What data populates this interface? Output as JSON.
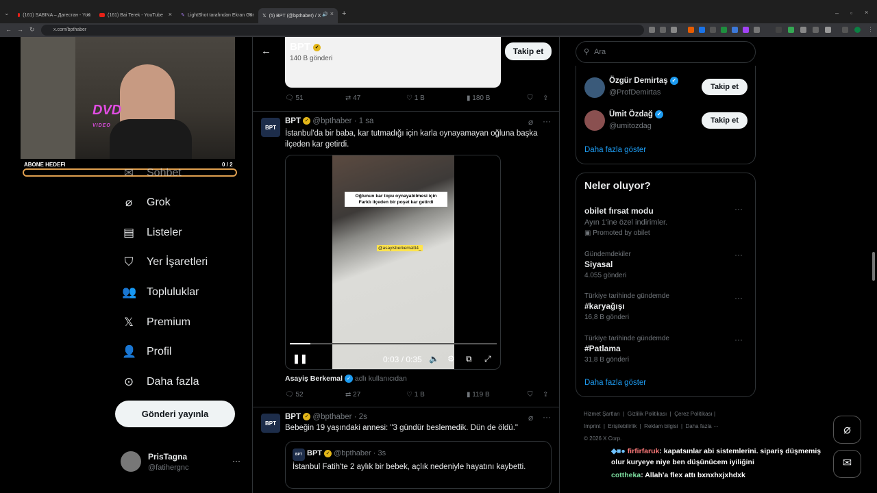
{
  "tabs": [
    {
      "label": "(161) SABINA – Дагестан - You"
    },
    {
      "label": "(161) Bai Terek - YouTube"
    },
    {
      "label": "LightShot tarafından Ekran Gör"
    },
    {
      "label": "(5) BPT (@bpthaber) / X"
    }
  ],
  "address": "x.com/bpthaber",
  "stream": {
    "goal_label": "ABONE HEDEFI",
    "goal_value": "0 / 2",
    "dvd_line1": "DVD",
    "dvd_line2": "VIDEO"
  },
  "nav": [
    {
      "label": "Sohbet",
      "icon": "mail-icon"
    },
    {
      "label": "Grok",
      "icon": "grok-icon"
    },
    {
      "label": "Listeler",
      "icon": "list-icon"
    },
    {
      "label": "Yer İşaretleri",
      "icon": "bookmark-icon"
    },
    {
      "label": "Topluluklar",
      "icon": "communities-icon"
    },
    {
      "label": "Premium",
      "icon": "x-logo-icon"
    },
    {
      "label": "Profil",
      "icon": "profile-icon"
    },
    {
      "label": "Daha fazla",
      "icon": "more-circle-icon"
    }
  ],
  "post_button": "Gönderi yayınla",
  "account": {
    "name": "PrisTagna",
    "handle": "@fatihergnc"
  },
  "header": {
    "title": "BPT",
    "subtitle": "140 B gönderi",
    "follow": "Takip et"
  },
  "prev_actions": {
    "replies": "51",
    "reposts": "47",
    "likes": "1 B",
    "views": "180 B"
  },
  "tweet1": {
    "name": "BPT",
    "handle": "@bpthaber",
    "time": "· 1 sa",
    "text": "İstanbul'da bir baba, kar tutmadığı için karla oynayamayan oğluna başka ilçeden kar getirdi.",
    "video_caption1": "Oğlunun kar topu oynayabilmesi için",
    "video_caption2": "Farklı ilçeden bir poşet kar getirdi",
    "video_tag": "@asayisberkemal34_",
    "time_display": "0:03 / 0:35",
    "progress": 0.1,
    "credit_name": "Asayiş Berkemal",
    "credit_suffix": "adlı kullanıcıdan",
    "replies": "52",
    "reposts": "27",
    "likes": "1 B",
    "views": "119 B"
  },
  "tweet2": {
    "name": "BPT",
    "handle": "@bpthaber",
    "time": "· 2s",
    "text": "Bebeğin 19 yaşındaki annesi: \"3 gündür beslemedik. Dün de öldü.\"",
    "quote_name": "BPT",
    "quote_handle": "@bpthaber",
    "quote_time": "· 3s",
    "quote_text": "İstanbul Fatih'te 2 aylık bir bebek, açlık nedeniyle hayatını kaybetti."
  },
  "search": {
    "placeholder": "Ara"
  },
  "follow_suggestions": [
    {
      "name": "Özgür Demirtaş",
      "handle": "@ProfDemirtas",
      "button": "Takip et"
    },
    {
      "name": "Ümit Özdağ",
      "handle": "@umitozdag",
      "button": "Takip et"
    }
  ],
  "show_more": "Daha fazla göster",
  "trends_title": "Neler oluyor?",
  "promo": {
    "title": "obilet fırsat modu",
    "desc": "Ayın 1'ine özel indirimler.",
    "promoted": "Promoted by obilet"
  },
  "trends": [
    {
      "context": "Gündemdekiler",
      "name": "Siyasal",
      "count": "4.055 gönderi"
    },
    {
      "context": "Türkiye tarihinde gündemde",
      "name": "#karyağışı",
      "count": "16,8 B gönderi"
    },
    {
      "context": "Türkiye tarihinde gündemde",
      "name": "#Patlama",
      "count": "31,8 B gönderi"
    }
  ],
  "show_more2": "Daha fazla göster",
  "footer": {
    "links": [
      "Hizmet Şartları",
      "Gizlilik Politikası",
      "Çerez Politikası",
      "Imprint",
      "Erişilebilirlik",
      "Reklam bilgisi",
      "Daha fazla ···"
    ],
    "copyright": "© 2026 X Corp."
  },
  "chat": [
    {
      "user": "firfirfaruk",
      "message": ": kapatsınlar abi sistemlerini. sipariş düşmemiş olur kuryeye niye ben düşünücem iyiliğini",
      "color": "#ff7a7a"
    },
    {
      "user": "cottheka",
      "message": ": Allah'a flex attı bxnxhxjxhdxk",
      "color": "#7ee0a1"
    }
  ]
}
